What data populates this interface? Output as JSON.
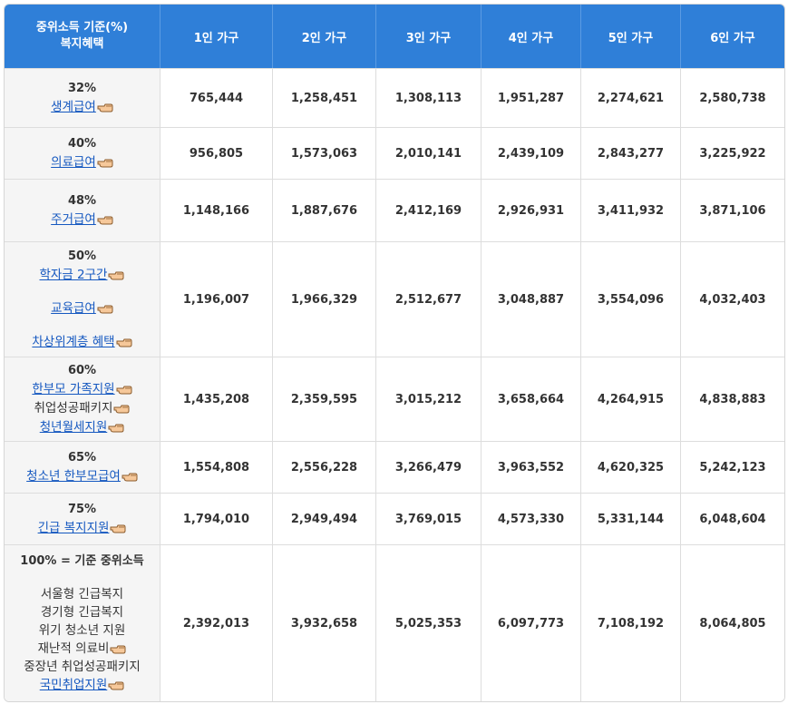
{
  "header": {
    "col0_line1": "중위소득 기준(%)",
    "col0_line2": "복지혜택",
    "cols": [
      "1인 가구",
      "2인 가구",
      "3인 가구",
      "4인 가구",
      "5인 가구",
      "6인 가구"
    ]
  },
  "rows": [
    {
      "pct": "32%",
      "links": [
        "생계급여"
      ],
      "values": [
        "765,444",
        "1,258,451",
        "1,308,113",
        "1,951,287",
        "2,274,621",
        "2,580,738"
      ]
    },
    {
      "pct": "40%",
      "links": [
        "의료급여"
      ],
      "values": [
        "956,805",
        "1,573,063",
        "2,010,141",
        "2,439,109",
        "2,843,277",
        "3,225,922"
      ]
    },
    {
      "pct": "48%",
      "links": [
        "주거급여"
      ],
      "values": [
        "1,148,166",
        "1,887,676",
        "2,412,169",
        "2,926,931",
        "3,411,932",
        "3,871,106"
      ]
    },
    {
      "pct": "50%",
      "links": [
        "학자금 2구간",
        "교육급여",
        "차상위계층 혜택"
      ],
      "values": [
        "1,196,007",
        "1,966,329",
        "2,512,677",
        "3,048,887",
        "3,554,096",
        "4,032,403"
      ]
    },
    {
      "pct": "60%",
      "links": [
        "한부모 가족지원",
        "취업성공패키지",
        "청년월세지원"
      ],
      "values": [
        "1,435,208",
        "2,359,595",
        "3,015,212",
        "3,658,664",
        "4,264,915",
        "4,838,883"
      ]
    },
    {
      "pct": "65%",
      "links": [
        "청소년 한부모급여"
      ],
      "values": [
        "1,554,808",
        "2,556,228",
        "3,266,479",
        "3,963,552",
        "4,620,325",
        "5,242,123"
      ]
    },
    {
      "pct": "75%",
      "links": [
        "긴급 복지지원"
      ],
      "values": [
        "1,794,010",
        "2,949,494",
        "3,769,015",
        "4,573,330",
        "5,331,144",
        "6,048,604"
      ]
    },
    {
      "pct": "100% = 기준 중위소득",
      "plain": [
        "서울형 긴급복지",
        "경기형 긴급복지",
        "위기 청소년 지원"
      ],
      "links": [
        "재난적 의료비",
        "중장년 취업성공패키지",
        "국민취업지원"
      ],
      "values": [
        "2,392,013",
        "3,932,658",
        "5,025,353",
        "6,097,773",
        "7,108,192",
        "8,064,805"
      ]
    }
  ]
}
